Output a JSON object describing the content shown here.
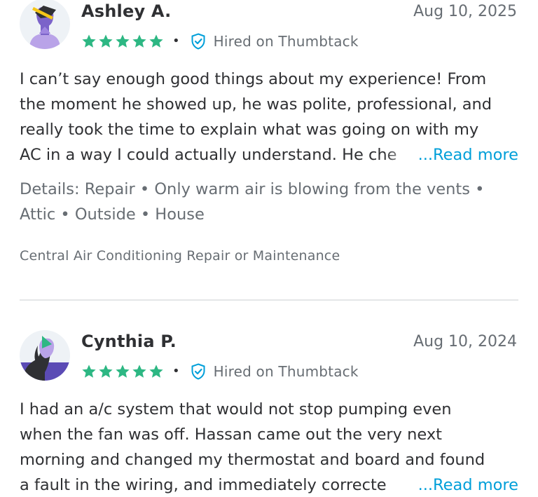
{
  "reviews": [
    {
      "name": "Ashley A.",
      "date": "Aug 10, 2025",
      "rating": 5,
      "hired_label": "Hired on Thumbtack",
      "separator": "•",
      "body_lines": [
        "I can’t say enough good things about my experience! From",
        "the moment he showed up, he was polite, professional, and",
        "really took the time to explain what was going on with my"
      ],
      "body_last": "AC in a way I could actually understand. He che",
      "read_more": "...Read more",
      "details_line1": "Details: Repair • Only warm air is blowing from the vents •",
      "details_line2": "Attic • Outside • House",
      "category": "Central Air Conditioning Repair or Maintenance"
    },
    {
      "name": "Cynthia P.",
      "date": "Aug 10, 2024",
      "rating": 5,
      "hired_label": "Hired on Thumbtack",
      "separator": "•",
      "body_lines": [
        "I had an a/c system that would not stop pumping even",
        "when the fan was off. Hassan came out the very next",
        "morning and changed my thermostat and board and found"
      ],
      "body_last": "a fault in the wiring, and immediately correcte",
      "read_more": "...Read more"
    }
  ],
  "colors": {
    "star": "#2db783",
    "accent": "#009fd9",
    "text": "#2f3033",
    "muted": "#676d73",
    "divider": "#e4e6e8"
  },
  "icons": {
    "star": "star-icon",
    "hired": "shield-check-icon"
  }
}
